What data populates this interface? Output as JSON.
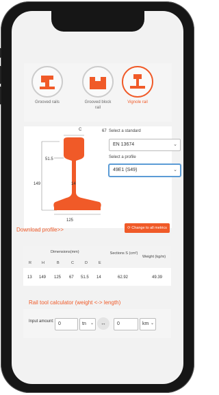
{
  "rail_types": [
    {
      "label": "Grooved rails"
    },
    {
      "label": "Grooved block rail"
    },
    {
      "label": "Vignole rail"
    }
  ],
  "profile_dims": {
    "C": "C",
    "top_width": "67",
    "head_height": "51.5",
    "height": "149",
    "web": "14",
    "base": "125"
  },
  "standard": {
    "label": "Select a standard",
    "value": "EN 13674"
  },
  "profile": {
    "label": "Select a profile",
    "value": "49E1 (S49)"
  },
  "download_link": "Download profile>>",
  "metric_button": "Change to all metrics",
  "table": {
    "group_header": "Dimensions(mm)",
    "sections_header": "Sections S (cm²)",
    "weight_header": "Weight (kg/m)",
    "columns": [
      "R",
      "H",
      "B",
      "C",
      "D",
      "E"
    ],
    "row": [
      "13",
      "149",
      "125",
      "67",
      "51.5",
      "14",
      "62.92",
      "49.39"
    ]
  },
  "calculator": {
    "title": "Rail tool calculator (weight <-> length)",
    "input_label": "Input amount:",
    "amount_value": "0",
    "unit_from": "tn",
    "swap_symbol": "↔",
    "result_value": "0",
    "unit_to": "km"
  },
  "colors": {
    "accent": "#f05a28",
    "frame": "#161616"
  }
}
